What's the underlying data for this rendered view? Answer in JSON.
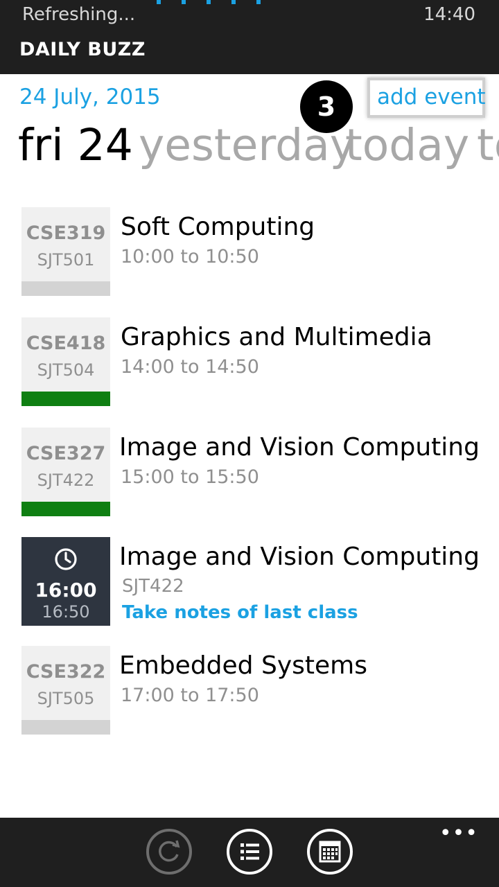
{
  "status_bar": {
    "text": "Refreshing...",
    "time": "14:40"
  },
  "app": {
    "title": "DAILY BUZZ"
  },
  "header": {
    "date": "24 July, 2015",
    "add_event_label": "add event",
    "badge": "3"
  },
  "pivot": {
    "items": [
      "fri 24",
      "yesterday",
      "today",
      "tomorrow"
    ],
    "selected": "fri 24"
  },
  "events": [
    {
      "code": "CSE319",
      "room": "SJT501",
      "title": "Soft Computing",
      "time": "10:00 to 10:50",
      "bar_color": "#d3d3d3"
    },
    {
      "code": "CSE418",
      "room": "SJT504",
      "title": "Graphics and Multimedia",
      "time": "14:00 to 14:50",
      "bar_color": "#0f7f12"
    },
    {
      "code": "CSE327",
      "room": "SJT422",
      "title": "Image and Vision Computing",
      "time": "15:00 to 15:50",
      "bar_color": "#0f7f12"
    },
    {
      "start": "16:00",
      "end": "16:50",
      "title": "Image and Vision Computing",
      "room": "SJT422",
      "note": "Take notes of last class",
      "icon": "clock-icon"
    },
    {
      "code": "CSE322",
      "room": "SJT505",
      "title": "Embedded Systems",
      "time": "17:00 to 17:50",
      "bar_color": "#d3d3d3"
    }
  ],
  "app_bar": {
    "buttons": [
      {
        "icon": "refresh-icon",
        "enabled": false
      },
      {
        "icon": "list-icon",
        "enabled": true
      },
      {
        "icon": "calendar-icon",
        "enabled": true
      }
    ],
    "more_label": "•••"
  },
  "colors": {
    "accent": "#1ba1e2",
    "attended": "#0f7f12",
    "neutral": "#d3d3d3",
    "chrome": "#1f1f1f"
  }
}
